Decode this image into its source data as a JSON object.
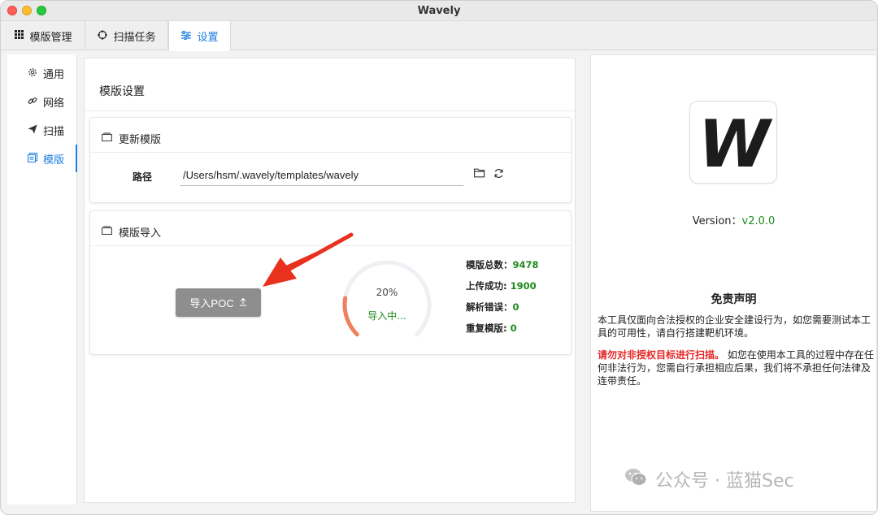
{
  "window": {
    "title": "Wavely"
  },
  "tabs": [
    {
      "label": "模版管理",
      "icon": "grid-icon"
    },
    {
      "label": "扫描任务",
      "icon": "crosshair-icon"
    },
    {
      "label": "设置",
      "icon": "sliders-icon"
    }
  ],
  "sidebar": {
    "items": [
      {
        "label": "通用",
        "icon": "gear-icon"
      },
      {
        "label": "网络",
        "icon": "link-icon"
      },
      {
        "label": "扫描",
        "icon": "send-icon"
      },
      {
        "label": "模版",
        "icon": "template-icon"
      }
    ]
  },
  "main": {
    "title": "模版设置",
    "update_card": {
      "title": "更新模版",
      "path_label": "路径",
      "path_value": "/Users/hsm/.wavely/templates/wavely"
    },
    "import_card": {
      "title": "模版导入",
      "button_label": "导入POC",
      "progress_percent": 20,
      "progress_text": "20%",
      "status": "导入中...",
      "stats": [
        {
          "label": "模版总数：",
          "value": "9478"
        },
        {
          "label": "上传成功:",
          "value": "1900"
        },
        {
          "label": "解析错误：",
          "value": "0"
        },
        {
          "label": "重复模版:",
          "value": "0"
        }
      ]
    }
  },
  "about": {
    "logo_letter": "W",
    "version_label": "Version：",
    "version_value": "v2.0.0",
    "disclaimer_title": "免责声明",
    "para1": "本工具仅面向合法授权的企业安全建设行为，如您需要测试本工具的可用性，请自行搭建靶机环境。",
    "para2_warning": "请勿对非授权目标进行扫描。",
    "para2_rest": "如您在使用本工具的过程中存在任何非法行为，您需自行承担相应后果，我们将不承担任何法律及连带责任。"
  },
  "watermark": {
    "text": "公众号 · 蓝猫Sec"
  },
  "colors": {
    "accent": "#1e7fe0",
    "success": "#1e8b1e",
    "warning": "#e52828",
    "progress": "#ef7f5f",
    "arrow": "#e8321e"
  }
}
